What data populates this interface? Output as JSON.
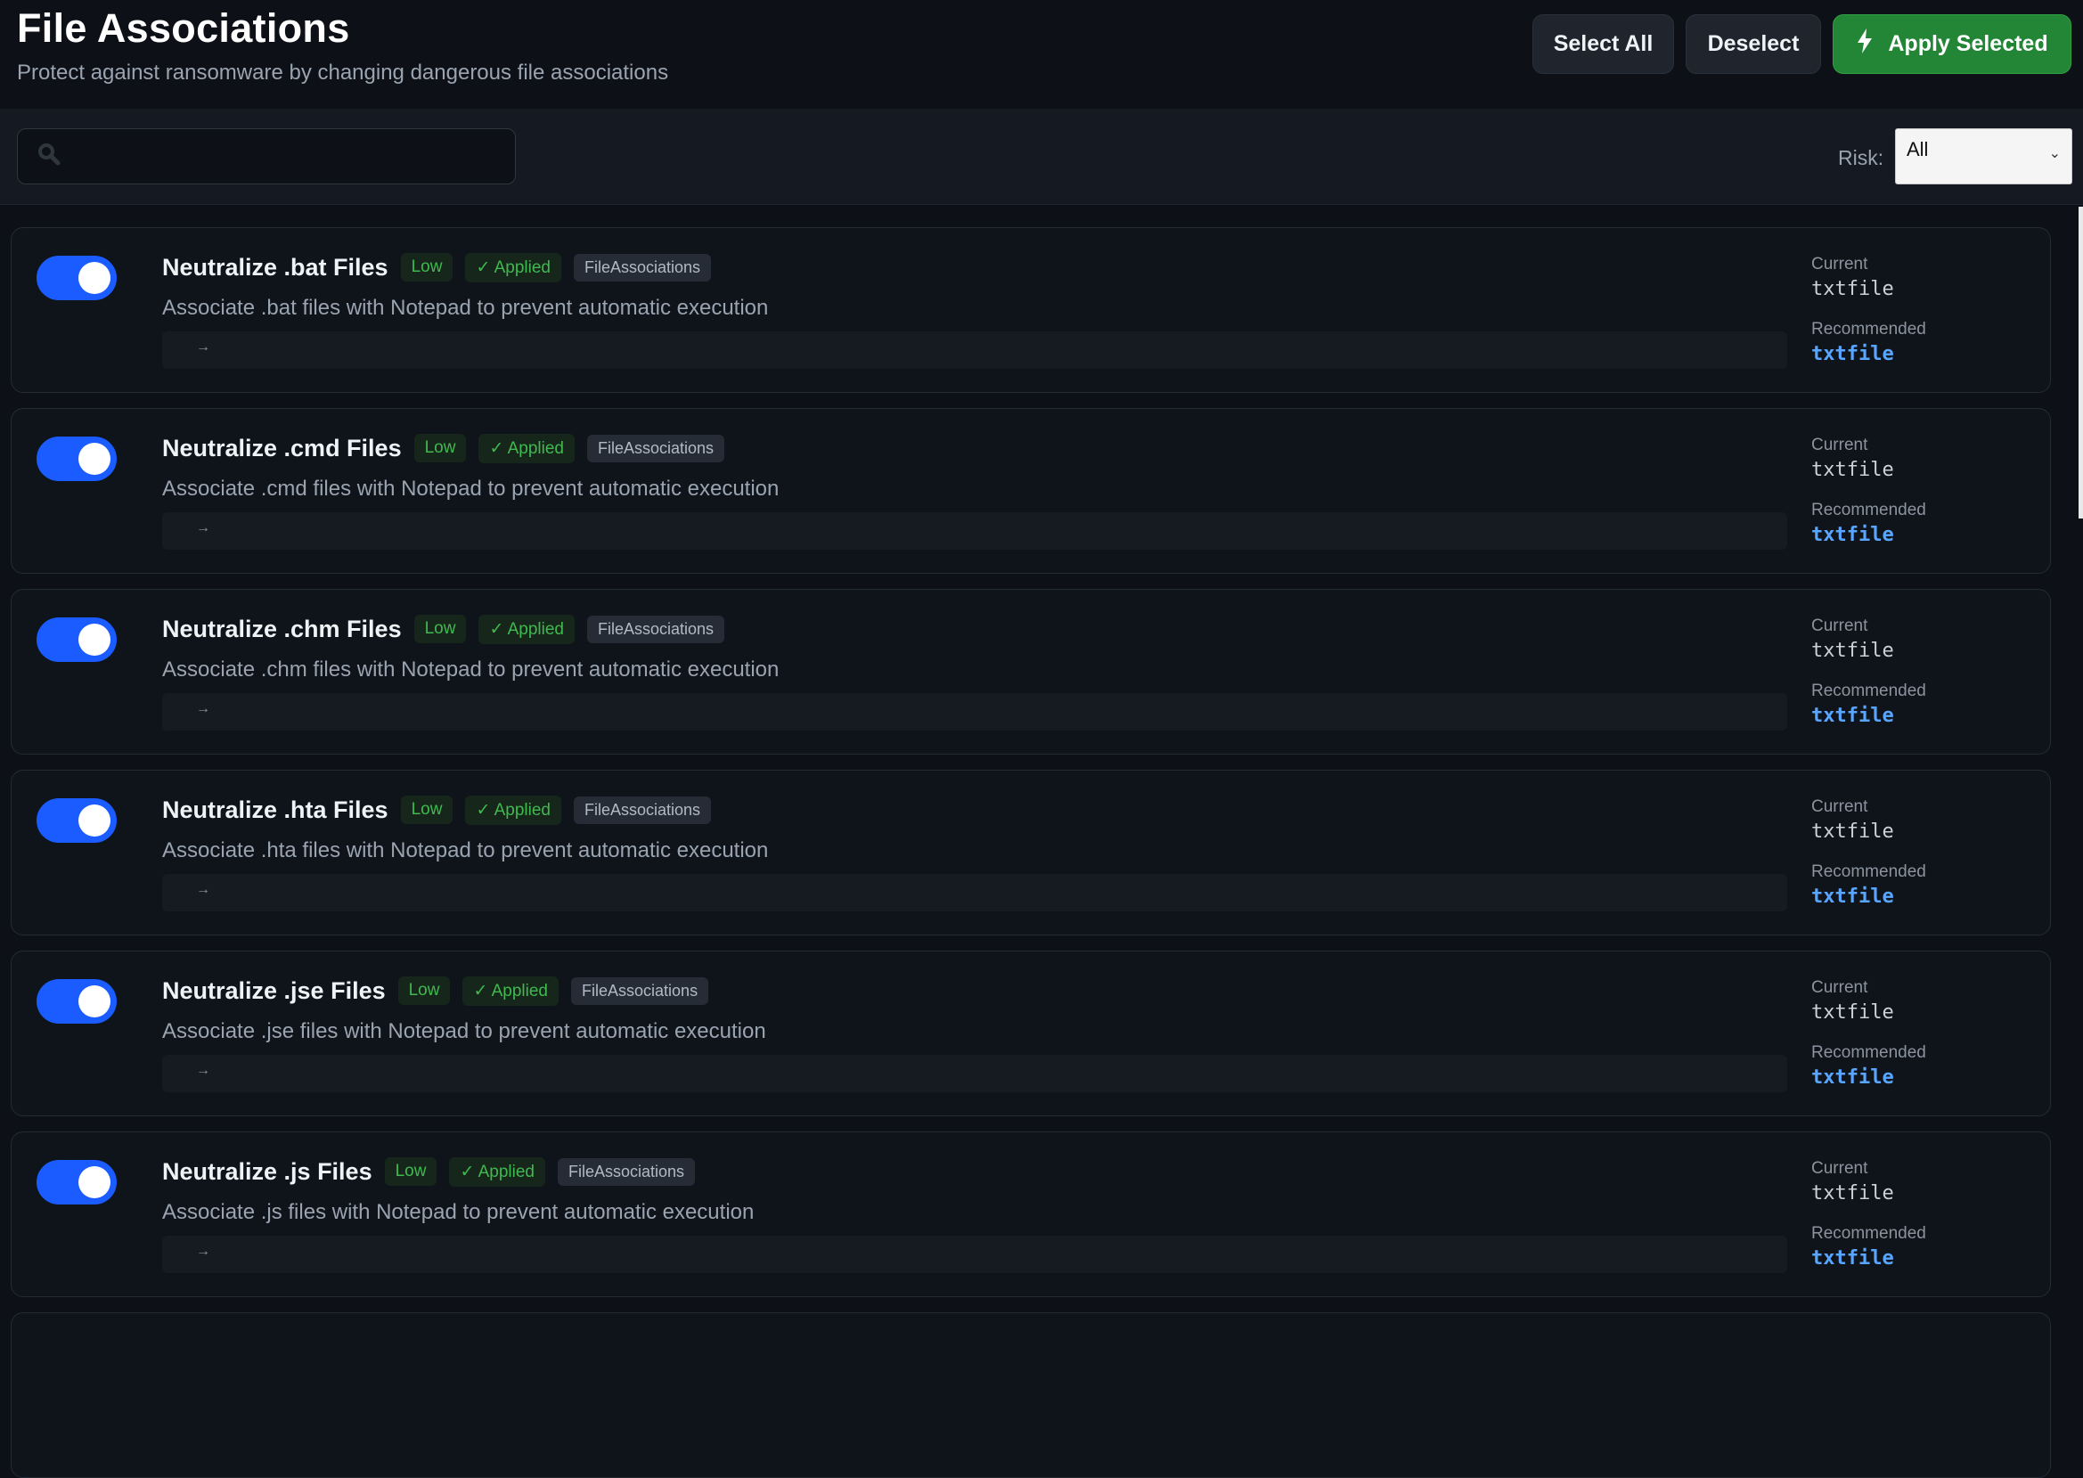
{
  "header": {
    "title": "File Associations",
    "subtitle": "Protect against ransomware by changing dangerous file associations",
    "select_all_label": "Select All",
    "deselect_label": "Deselect",
    "apply_label": "Apply Selected",
    "apply_icon": "lightning-bolt-icon"
  },
  "filter": {
    "search_value": "",
    "search_icon": "search-icon",
    "risk_label": "Risk:",
    "risk_value": "All"
  },
  "colors": {
    "toggle_on": "#1a5cff",
    "apply_green": "#238636",
    "risk_low": "#3fb950",
    "recommended_blue": "#58a6ff"
  },
  "items": [
    {
      "title": "Neutralize .bat Files",
      "risk": "Low",
      "status": "✓ Applied",
      "category": "FileAssociations",
      "description": "Associate .bat files with Notepad to prevent automatic execution",
      "arrow": "→",
      "current_label": "Current",
      "current_value": "txtfile",
      "recommended_label": "Recommended",
      "recommended_value": "txtfile",
      "enabled": true
    },
    {
      "title": "Neutralize .cmd Files",
      "risk": "Low",
      "status": "✓ Applied",
      "category": "FileAssociations",
      "description": "Associate .cmd files with Notepad to prevent automatic execution",
      "arrow": "→",
      "current_label": "Current",
      "current_value": "txtfile",
      "recommended_label": "Recommended",
      "recommended_value": "txtfile",
      "enabled": true
    },
    {
      "title": "Neutralize .chm Files",
      "risk": "Low",
      "status": "✓ Applied",
      "category": "FileAssociations",
      "description": "Associate .chm files with Notepad to prevent automatic execution",
      "arrow": "→",
      "current_label": "Current",
      "current_value": "txtfile",
      "recommended_label": "Recommended",
      "recommended_value": "txtfile",
      "enabled": true
    },
    {
      "title": "Neutralize .hta Files",
      "risk": "Low",
      "status": "✓ Applied",
      "category": "FileAssociations",
      "description": "Associate .hta files with Notepad to prevent automatic execution",
      "arrow": "→",
      "current_label": "Current",
      "current_value": "txtfile",
      "recommended_label": "Recommended",
      "recommended_value": "txtfile",
      "enabled": true
    },
    {
      "title": "Neutralize .jse Files",
      "risk": "Low",
      "status": "✓ Applied",
      "category": "FileAssociations",
      "description": "Associate .jse files with Notepad to prevent automatic execution",
      "arrow": "→",
      "current_label": "Current",
      "current_value": "txtfile",
      "recommended_label": "Recommended",
      "recommended_value": "txtfile",
      "enabled": true
    },
    {
      "title": "Neutralize .js Files",
      "risk": "Low",
      "status": "✓ Applied",
      "category": "FileAssociations",
      "description": "Associate .js files with Notepad to prevent automatic execution",
      "arrow": "→",
      "current_label": "Current",
      "current_value": "txtfile",
      "recommended_label": "Recommended",
      "recommended_value": "txtfile",
      "enabled": true
    }
  ]
}
